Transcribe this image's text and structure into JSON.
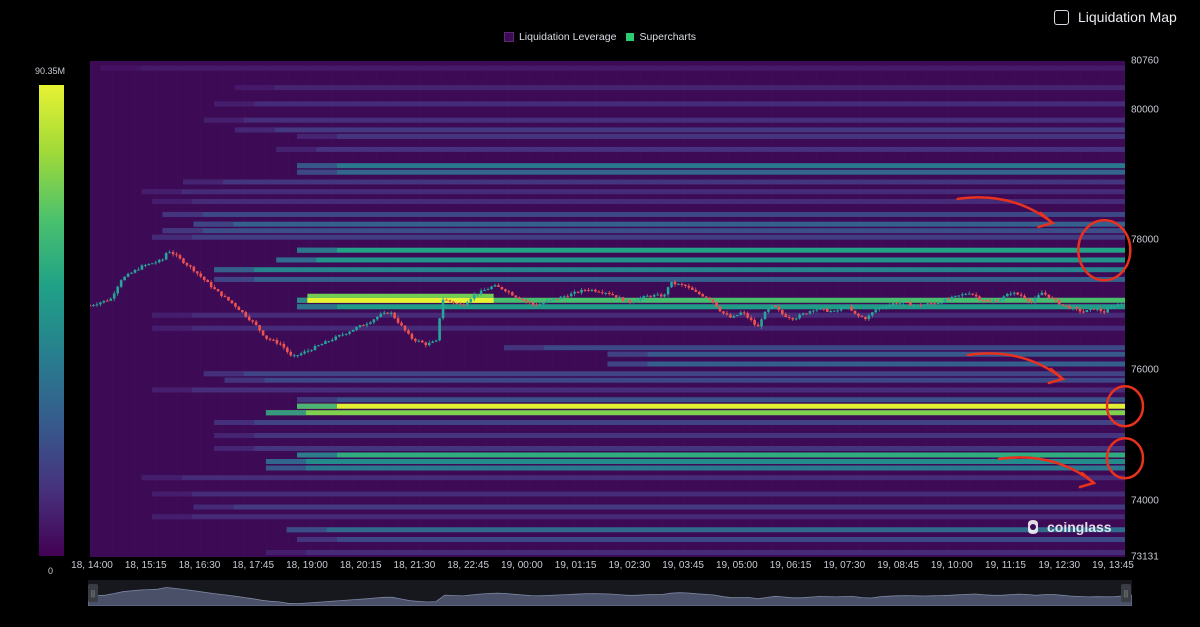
{
  "toggle": {
    "label": "Liquidation Map"
  },
  "legend": [
    {
      "label": "Liquidation Leverage",
      "color": "#3d0a55"
    },
    {
      "label": "Supercharts",
      "color": "#2ecc71"
    }
  ],
  "colorbar": {
    "max_label": "90.35M",
    "min_label": "0"
  },
  "logo": {
    "text": "coinglass"
  },
  "chart_data": {
    "type": "heatmap",
    "y_ticks": [
      "80760",
      "80000",
      "78000",
      "76000",
      "74000",
      "73131"
    ],
    "x_ticks": [
      "18, 14:00",
      "18, 15:15",
      "18, 16:30",
      "18, 17:45",
      "18, 19:00",
      "18, 20:15",
      "18, 21:30",
      "18, 22:45",
      "19, 00:00",
      "19, 01:15",
      "19, 02:30",
      "19, 03:45",
      "19, 05:00",
      "19, 06:15",
      "19, 07:30",
      "19, 08:45",
      "19, 10:00",
      "19, 11:15",
      "19, 12:30",
      "19, 13:45"
    ],
    "ylim": [
      73131,
      80760
    ],
    "color_range": [
      0,
      90350000
    ],
    "liquidation_bands": [
      {
        "price": 80650,
        "start": 0.01,
        "intensity": 0.07
      },
      {
        "price": 80350,
        "start": 0.14,
        "intensity": 0.1
      },
      {
        "price": 80100,
        "start": 0.12,
        "intensity": 0.12
      },
      {
        "price": 79850,
        "start": 0.11,
        "intensity": 0.13
      },
      {
        "price": 79700,
        "start": 0.14,
        "intensity": 0.16
      },
      {
        "price": 79600,
        "start": 0.2,
        "intensity": 0.15
      },
      {
        "price": 79400,
        "start": 0.18,
        "intensity": 0.14
      },
      {
        "price": 79150,
        "start": 0.2,
        "intensity": 0.4
      },
      {
        "price": 79050,
        "start": 0.2,
        "intensity": 0.33
      },
      {
        "price": 78900,
        "start": 0.09,
        "intensity": 0.15
      },
      {
        "price": 78750,
        "start": 0.05,
        "intensity": 0.12
      },
      {
        "price": 78600,
        "start": 0.06,
        "intensity": 0.12
      },
      {
        "price": 78400,
        "start": 0.07,
        "intensity": 0.22
      },
      {
        "price": 78250,
        "start": 0.1,
        "intensity": 0.3
      },
      {
        "price": 78150,
        "start": 0.07,
        "intensity": 0.24
      },
      {
        "price": 78050,
        "start": 0.06,
        "intensity": 0.18
      },
      {
        "price": 77850,
        "start": 0.2,
        "intensity": 0.58
      },
      {
        "price": 77700,
        "start": 0.18,
        "intensity": 0.52
      },
      {
        "price": 77550,
        "start": 0.12,
        "intensity": 0.45
      },
      {
        "price": 77400,
        "start": 0.12,
        "intensity": 0.3
      },
      {
        "price": 77080,
        "start": 0.2,
        "intensity": 0.7
      },
      {
        "price": 76980,
        "start": 0.2,
        "intensity": 0.55
      },
      {
        "price": 76850,
        "start": 0.06,
        "intensity": 0.12
      },
      {
        "price": 76650,
        "start": 0.06,
        "intensity": 0.12
      },
      {
        "price": 76350,
        "start": 0.4,
        "intensity": 0.22
      },
      {
        "price": 76250,
        "start": 0.5,
        "intensity": 0.28
      },
      {
        "price": 76100,
        "start": 0.5,
        "intensity": 0.3
      },
      {
        "price": 75950,
        "start": 0.11,
        "intensity": 0.2
      },
      {
        "price": 75850,
        "start": 0.13,
        "intensity": 0.22
      },
      {
        "price": 75700,
        "start": 0.06,
        "intensity": 0.13
      },
      {
        "price": 75550,
        "start": 0.2,
        "intensity": 0.25
      },
      {
        "price": 75450,
        "start": 0.2,
        "intensity": 0.99
      },
      {
        "price": 75350,
        "start": 0.17,
        "intensity": 0.8
      },
      {
        "price": 75200,
        "start": 0.12,
        "intensity": 0.2
      },
      {
        "price": 75000,
        "start": 0.12,
        "intensity": 0.15
      },
      {
        "price": 74800,
        "start": 0.12,
        "intensity": 0.15
      },
      {
        "price": 74700,
        "start": 0.2,
        "intensity": 0.62
      },
      {
        "price": 74600,
        "start": 0.17,
        "intensity": 0.48
      },
      {
        "price": 74500,
        "start": 0.17,
        "intensity": 0.4
      },
      {
        "price": 74350,
        "start": 0.05,
        "intensity": 0.12
      },
      {
        "price": 74100,
        "start": 0.06,
        "intensity": 0.12
      },
      {
        "price": 73900,
        "start": 0.1,
        "intensity": 0.17
      },
      {
        "price": 73750,
        "start": 0.06,
        "intensity": 0.12
      },
      {
        "price": 73550,
        "start": 0.19,
        "intensity": 0.35
      },
      {
        "price": 73400,
        "start": 0.2,
        "intensity": 0.22
      },
      {
        "price": 73200,
        "start": 0.17,
        "intensity": 0.12
      }
    ],
    "hot_zones": [
      {
        "price_top": 77115,
        "price_bottom": 77040,
        "start": 0.21,
        "end": 0.39,
        "intensity": 1.0
      },
      {
        "price_top": 77180,
        "price_bottom": 77115,
        "start": 0.21,
        "end": 0.39,
        "intensity": 0.78
      }
    ],
    "price_path": [
      [
        0.0,
        77000
      ],
      [
        0.02,
        77100
      ],
      [
        0.03,
        77400
      ],
      [
        0.05,
        77600
      ],
      [
        0.07,
        77700
      ],
      [
        0.075,
        77850
      ],
      [
        0.08,
        77800
      ],
      [
        0.1,
        77550
      ],
      [
        0.12,
        77250
      ],
      [
        0.14,
        77000
      ],
      [
        0.15,
        76850
      ],
      [
        0.16,
        76700
      ],
      [
        0.17,
        76500
      ],
      [
        0.185,
        76400
      ],
      [
        0.195,
        76200
      ],
      [
        0.21,
        76300
      ],
      [
        0.23,
        76450
      ],
      [
        0.25,
        76600
      ],
      [
        0.27,
        76750
      ],
      [
        0.28,
        76850
      ],
      [
        0.29,
        76900
      ],
      [
        0.3,
        76700
      ],
      [
        0.31,
        76500
      ],
      [
        0.325,
        76400
      ],
      [
        0.335,
        76450
      ],
      [
        0.34,
        77100
      ],
      [
        0.36,
        77000
      ],
      [
        0.37,
        77150
      ],
      [
        0.39,
        77300
      ],
      [
        0.4,
        77250
      ],
      [
        0.41,
        77150
      ],
      [
        0.43,
        77000
      ],
      [
        0.46,
        77150
      ],
      [
        0.48,
        77250
      ],
      [
        0.5,
        77200
      ],
      [
        0.52,
        77050
      ],
      [
        0.54,
        77150
      ],
      [
        0.555,
        77150
      ],
      [
        0.56,
        77350
      ],
      [
        0.575,
        77300
      ],
      [
        0.585,
        77200
      ],
      [
        0.6,
        77100
      ],
      [
        0.61,
        76900
      ],
      [
        0.62,
        76800
      ],
      [
        0.63,
        76900
      ],
      [
        0.64,
        76750
      ],
      [
        0.645,
        76650
      ],
      [
        0.65,
        76850
      ],
      [
        0.66,
        77000
      ],
      [
        0.67,
        76850
      ],
      [
        0.68,
        76800
      ],
      [
        0.7,
        76950
      ],
      [
        0.72,
        76900
      ],
      [
        0.73,
        77000
      ],
      [
        0.74,
        76850
      ],
      [
        0.75,
        76800
      ],
      [
        0.76,
        76950
      ],
      [
        0.78,
        77050
      ],
      [
        0.8,
        77000
      ],
      [
        0.82,
        77050
      ],
      [
        0.84,
        77150
      ],
      [
        0.85,
        77200
      ],
      [
        0.86,
        77100
      ],
      [
        0.87,
        77050
      ],
      [
        0.88,
        77100
      ],
      [
        0.89,
        77200
      ],
      [
        0.9,
        77150
      ],
      [
        0.91,
        77050
      ],
      [
        0.92,
        77200
      ],
      [
        0.93,
        77100
      ],
      [
        0.94,
        77000
      ],
      [
        0.95,
        76950
      ],
      [
        0.96,
        76900
      ],
      [
        0.97,
        76950
      ],
      [
        0.98,
        76900
      ],
      [
        0.99,
        77000
      ],
      [
        1.0,
        77050
      ]
    ],
    "annotations": [
      {
        "type": "circle",
        "price": 77850,
        "t": 0.98
      },
      {
        "type": "circle",
        "price": 75450,
        "t": 1.0
      },
      {
        "type": "circle",
        "price": 74650,
        "t": 1.0
      },
      {
        "type": "arrow",
        "price": 78300,
        "t": 0.93
      },
      {
        "type": "arrow",
        "price": 75900,
        "t": 0.94
      },
      {
        "type": "arrow",
        "price": 74300,
        "t": 0.97
      }
    ]
  }
}
